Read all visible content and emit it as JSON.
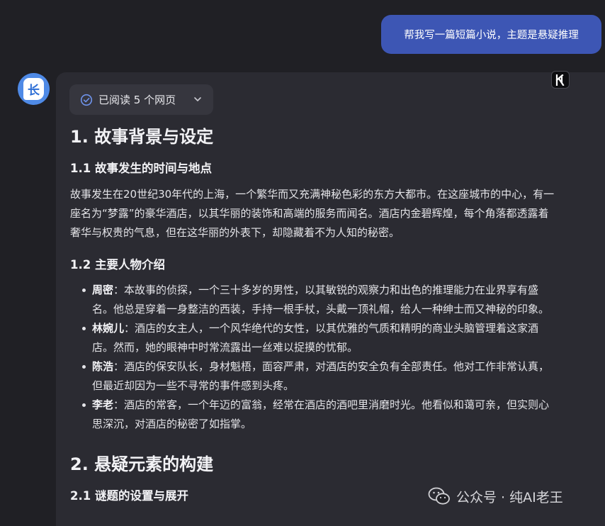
{
  "user_message": "帮我写一篇短篇小说，主题是悬疑推理",
  "assistant": {
    "avatar_text": "长",
    "badge_text": "K",
    "sources_label": "已阅读 5 个网页"
  },
  "article": {
    "h1_1": "1. 故事背景与设定",
    "h2_1_1": "1.1 故事发生的时间与地点",
    "para_1_lines": [
      "故事发生在20世纪30年代的上海，一个繁华而又充满神秘色彩的东方大都市。在这座城市的中心，有一",
      "座名为“梦露”的豪华酒店，以其华丽的装饰和高端的服务而闻名。酒店内金碧辉煌，每个角落都透露着",
      "奢华与权贵的气息，但在这华丽的外表下，却隐藏着不为人知的秘密。"
    ],
    "h2_1_2": "1.2 主要人物介绍",
    "characters": [
      {
        "name": "周密",
        "sep": "：",
        "line1": "本故事的侦探，一个三十多岁的男性，以其敏锐的观察力和出色的推理能力在业界享有盛",
        "line2": "名。他总是穿着一身整洁的西装，手持一根手杖，头戴一顶礼帽，给人一种绅士而又神秘的印象。"
      },
      {
        "name": "林婉儿",
        "sep": "：",
        "line1": "酒店的女主人，一个风华绝代的女性，以其优雅的气质和精明的商业头脑管理着这家酒",
        "line2": "店。然而，她的眼神中时常流露出一丝难以捉摸的忧郁。"
      },
      {
        "name": "陈浩",
        "sep": "：",
        "line1": "酒店的保安队长，身材魁梧，面容严肃，对酒店的安全负有全部责任。他对工作非常认真，",
        "line2": "但最近却因为一些不寻常的事件感到头疼。"
      },
      {
        "name": "李老",
        "sep": "：",
        "line1": "酒店的常客，一个年迈的富翁，经常在酒店的酒吧里消磨时光。他看似和蔼可亲，但实则心",
        "line2": "思深沉，对酒店的秘密了如指掌。"
      }
    ],
    "h1_2": "2. 悬疑元素的构建",
    "h2_2_1": "2.1 谜题的设置与展开"
  },
  "watermark": "公众号 · 纯AI老王",
  "colors": {
    "background": "#202025",
    "card": "#2b2b32",
    "user_bubble": "#3d56b4",
    "accent": "#4f8ae6"
  }
}
